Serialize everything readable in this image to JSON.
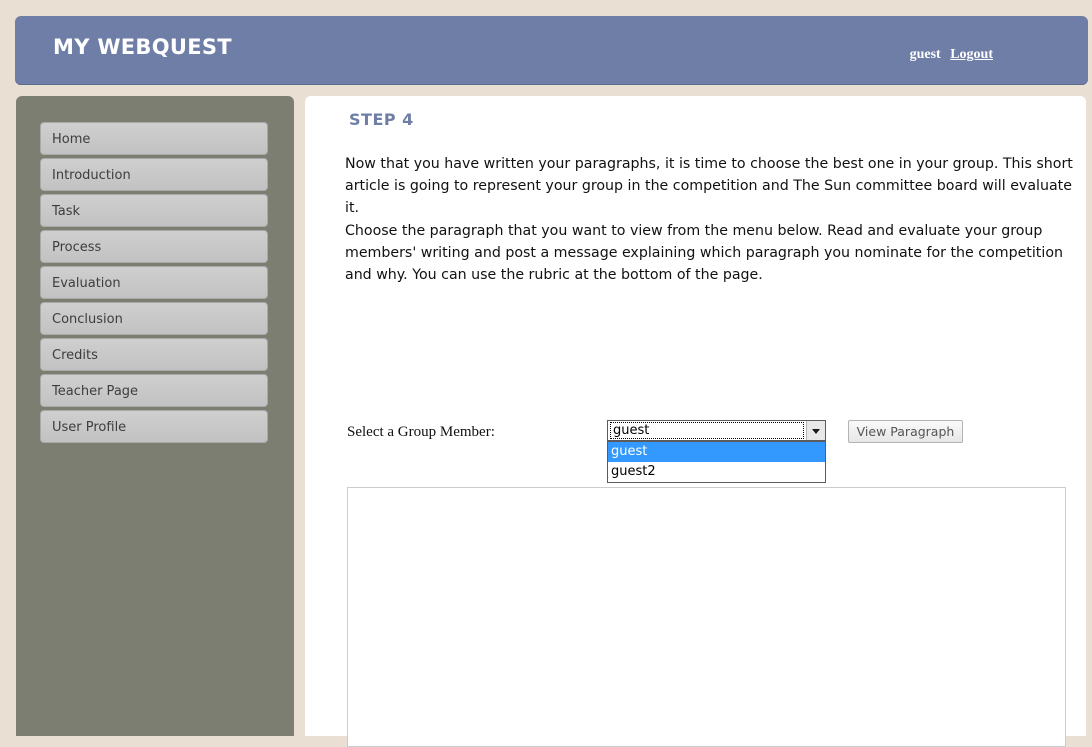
{
  "header": {
    "title": "MY WEBQUEST",
    "username": "guest",
    "logout_label": "Logout"
  },
  "sidebar": {
    "items": [
      {
        "label": "Home"
      },
      {
        "label": "Introduction"
      },
      {
        "label": "Task"
      },
      {
        "label": "Process"
      },
      {
        "label": "Evaluation"
      },
      {
        "label": "Conclusion"
      },
      {
        "label": "Credits"
      },
      {
        "label": "Teacher Page"
      },
      {
        "label": "User Profile"
      }
    ]
  },
  "main": {
    "step_title": "STEP 4",
    "paragraph_1": "Now that you have written your paragraphs, it is time to choose the best one in your group. This short article is going to represent your group in the competition and The Sun committee board will evaluate it.",
    "paragraph_2": "Choose the paragraph that you want to view from the menu below. Read and evaluate your group members' writing and  post a message explaining which paragraph you nominate for the competition and why. You can use the rubric at the bottom of the page.",
    "select_label": "Select a Group Member:",
    "select_value": "guest",
    "select_options": [
      "guest",
      "guest2"
    ],
    "view_button_label": "View Paragraph"
  },
  "colors": {
    "header_bg": "#6f7ea6",
    "sidebar_bg": "#7b7e71",
    "page_bg": "#e9dfd2",
    "highlight": "#3399ff"
  }
}
